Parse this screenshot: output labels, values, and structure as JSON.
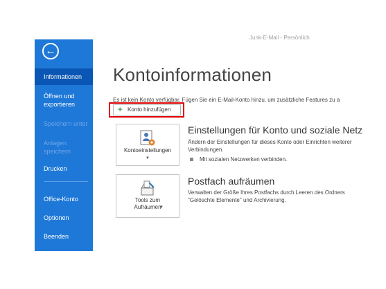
{
  "window": {
    "title": "Junk-E-Mail - Persönlich"
  },
  "sidebar": {
    "items": [
      {
        "label": "Informationen",
        "active": true,
        "enabled": true
      },
      {
        "label": "Öffnen und exportieren",
        "enabled": true
      },
      {
        "label": "Speichern unter",
        "enabled": false
      },
      {
        "label": "Anlagen speichern",
        "enabled": false
      },
      {
        "label": "Drucken",
        "enabled": true
      },
      {
        "label": "Office-Konto",
        "enabled": true
      },
      {
        "label": "Optionen",
        "enabled": true
      },
      {
        "label": "Beenden",
        "enabled": true
      }
    ],
    "accent": "#1e78d7"
  },
  "main": {
    "title": "Kontoinformationen",
    "info_text": "Es ist kein Konto verfügbar. Fügen Sie ein E-Mail-Konto hinzu, um zusätzliche Features zu a",
    "add_account_label": "Konto hinzufügen",
    "sections": [
      {
        "tile_label": "Kontoeinstellungen",
        "title": "Einstellungen für Konto und soziale Netz",
        "description": "Ändern der Einstellungen für dieses Konto oder Einrichten weiterer Verbindungen.",
        "bullet": "Mit sozialen Netzwerken verbinden."
      },
      {
        "tile_label": "Tools zum Aufräumen",
        "title": "Postfach aufräumen",
        "description": "Verwalten der Größe Ihres Postfachs durch Leeren des Ordners \"Gelöschte Elemente\" und Archivierung."
      }
    ]
  }
}
